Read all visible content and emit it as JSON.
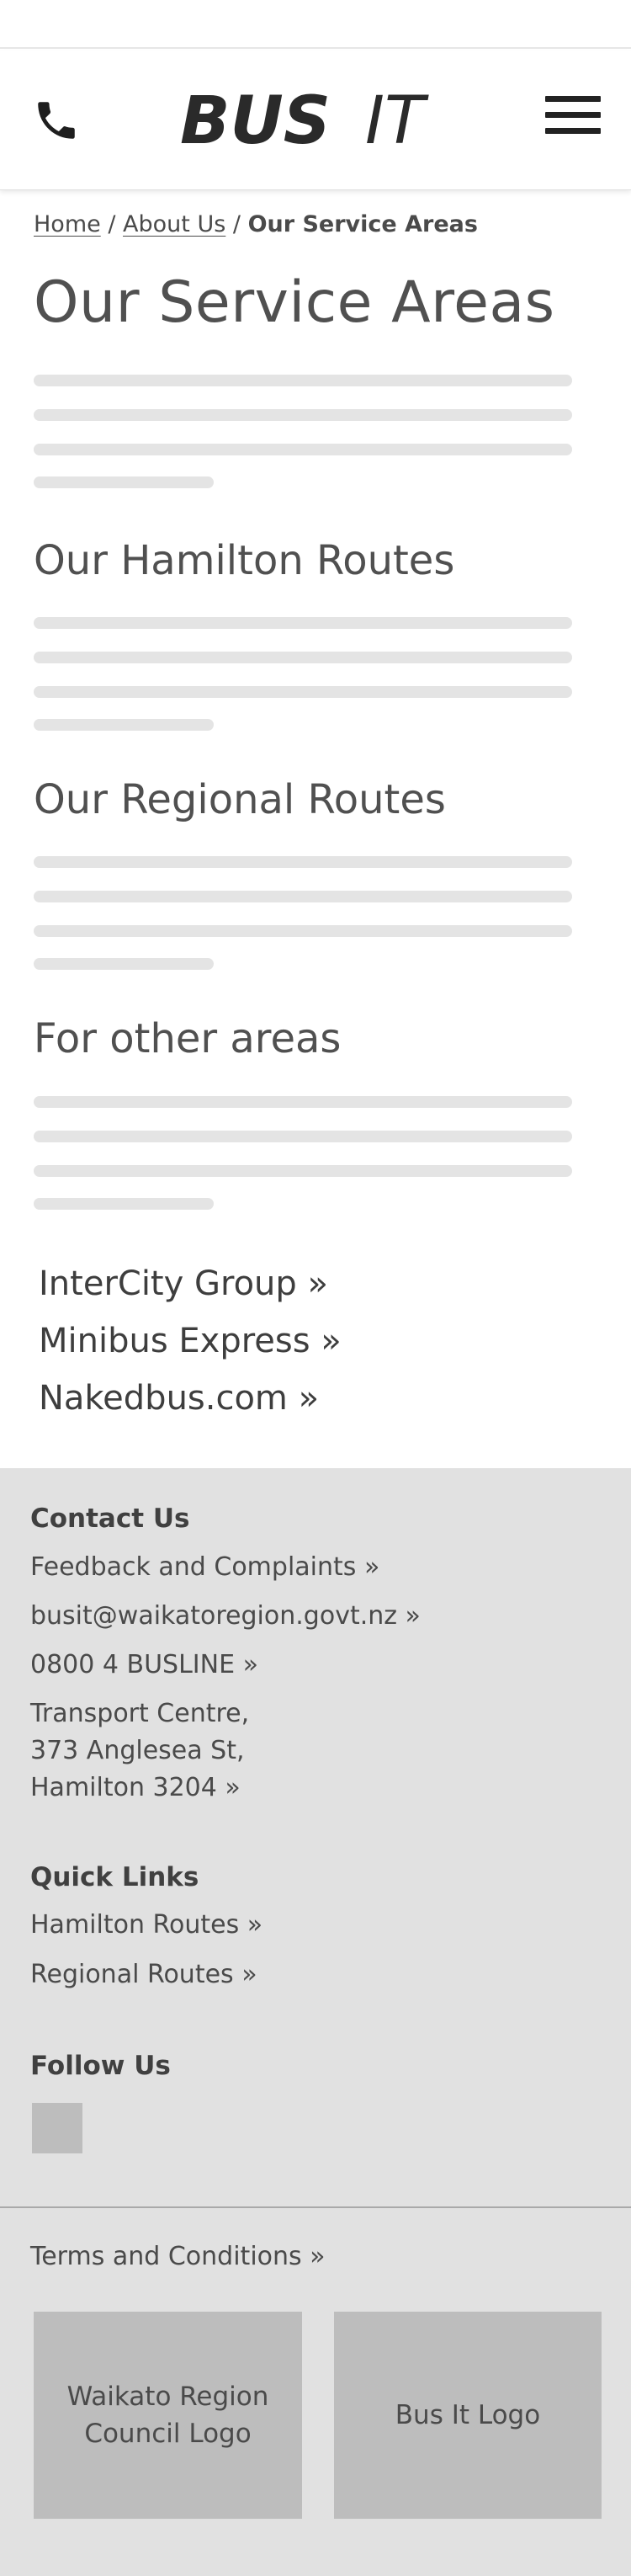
{
  "header": {
    "logo_text": "BUSIT",
    "logo_bold": "BUS",
    "logo_light": "IT"
  },
  "breadcrumb": {
    "home": "Home",
    "about": "About Us",
    "current": "Our Service Areas",
    "separator": "/"
  },
  "page": {
    "title": "Our Service Areas",
    "sections": [
      {
        "title": "Our Hamilton Routes"
      },
      {
        "title": "Our Regional Routes"
      },
      {
        "title": "For other areas"
      }
    ]
  },
  "external_links": [
    {
      "label": "InterCity Group »"
    },
    {
      "label": "Minibus Express »"
    },
    {
      "label": "Nakedbus.com »"
    }
  ],
  "footer": {
    "contact_heading": "Contact Us",
    "contact": {
      "feedback": "Feedback and Complaints »",
      "email": "busit@waikatoregion.govt.nz »",
      "phone": "0800 4 BUSLINE »",
      "address_line1": "Transport Centre,",
      "address_line2": "373 Anglesea St,",
      "address_line3": "Hamilton 3204 »"
    },
    "quicklinks_heading": "Quick Links",
    "quicklinks": [
      {
        "label": "Hamilton Routes »"
      },
      {
        "label": "Regional Routes »"
      }
    ],
    "follow_heading": "Follow Us",
    "terms": "Terms and Conditions »",
    "logo_waikato_line1": "Waikato Region",
    "logo_waikato_line2": "Council Logo",
    "logo_busit": "Bus It Logo"
  },
  "colors": {
    "text": "#4a4a4a",
    "skeleton": "#e4e4e4",
    "footer_bg": "#e1e1e1",
    "placeholder": "#bdbdbd"
  },
  "icons": [
    "phone-icon",
    "hamburger-menu-icon",
    "social-icon-placeholder"
  ]
}
